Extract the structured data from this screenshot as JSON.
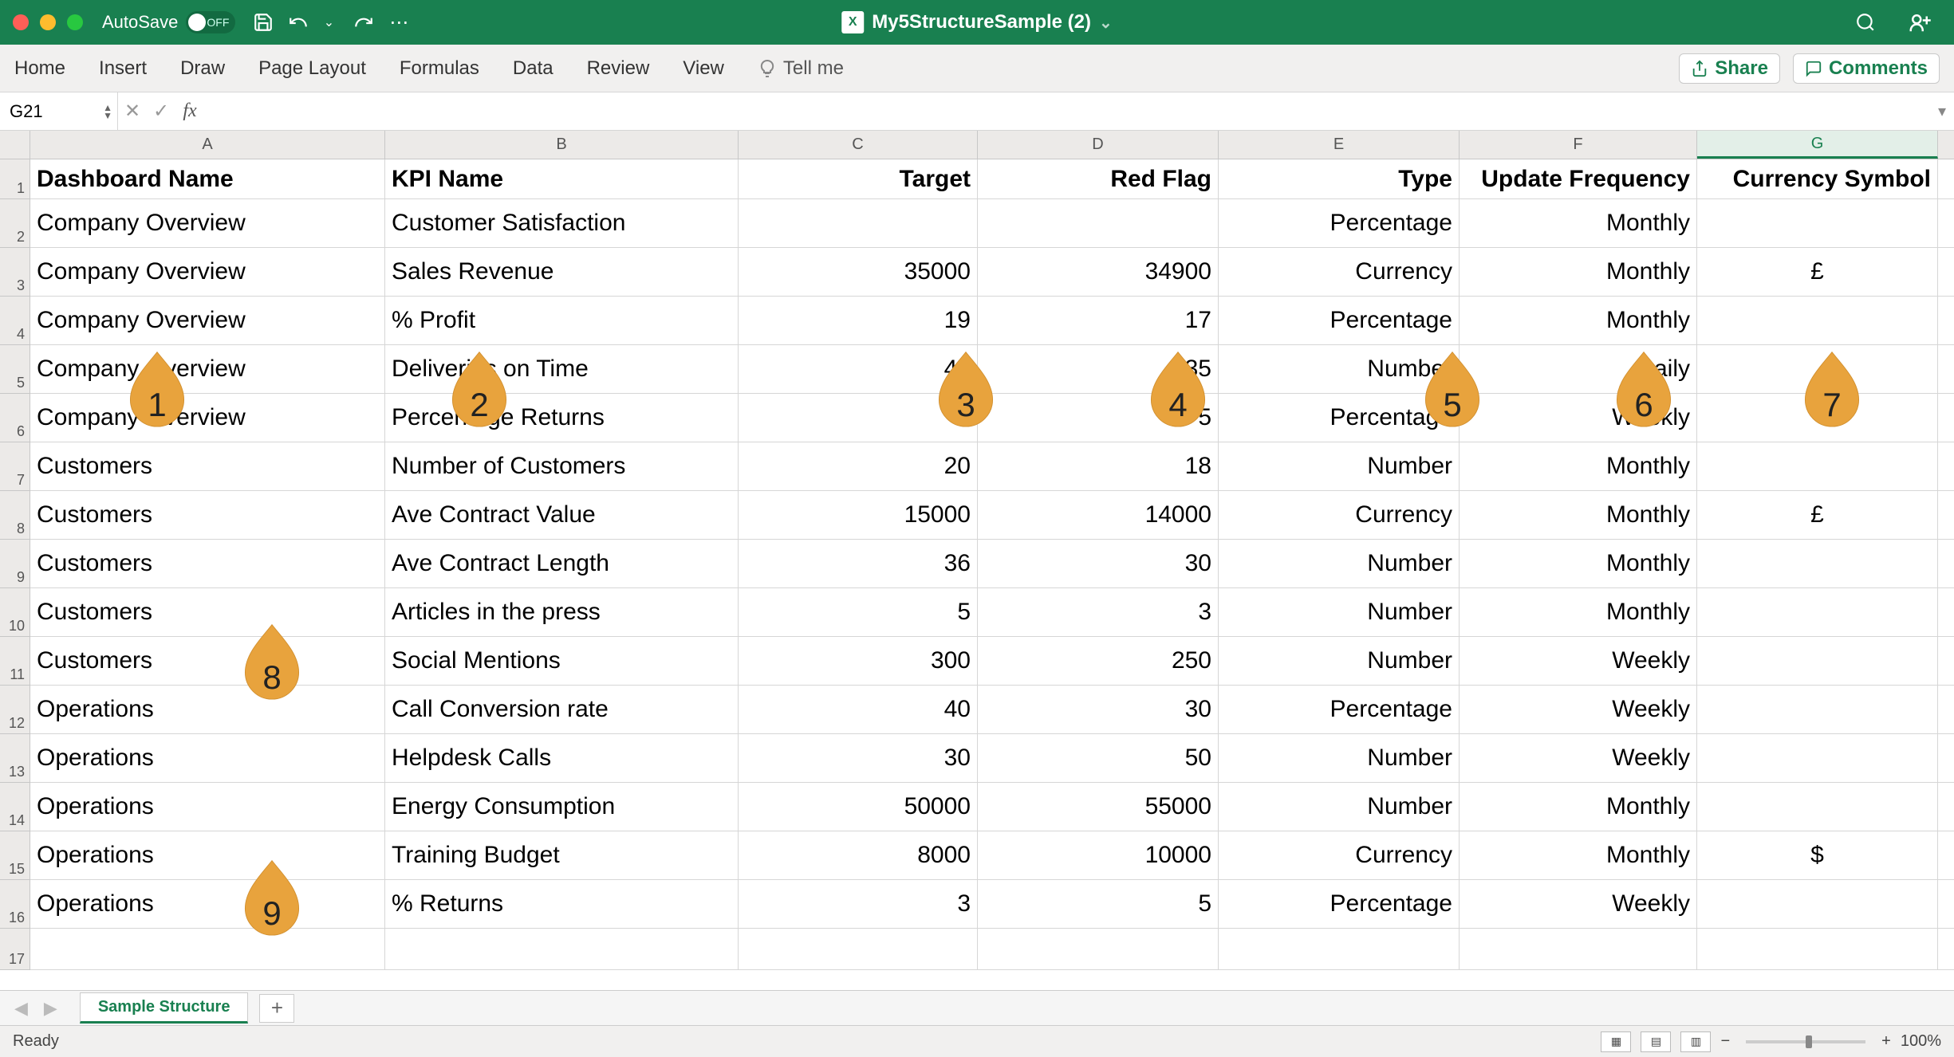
{
  "titlebar": {
    "autosave_label": "AutoSave",
    "autosave_state": "OFF",
    "doc_title": "My5StructureSample (2)"
  },
  "ribbon": {
    "tabs": [
      "Home",
      "Insert",
      "Draw",
      "Page Layout",
      "Formulas",
      "Data",
      "Review",
      "View"
    ],
    "tellme": "Tell me",
    "share": "Share",
    "comments": "Comments"
  },
  "formula_bar": {
    "namebox": "G21",
    "formula": ""
  },
  "columns": [
    "A",
    "B",
    "C",
    "D",
    "E",
    "F",
    "G"
  ],
  "selected_col": "G",
  "headers": {
    "A": "Dashboard Name",
    "B": "KPI Name",
    "C": "Target",
    "D": "Red Flag",
    "E": "Type",
    "F": "Update Frequency",
    "G": "Currency Symbol"
  },
  "rows": [
    {
      "n": 2,
      "A": "Company Overview",
      "B": "Customer Satisfaction",
      "C": "",
      "D": "",
      "E": "Percentage",
      "F": "Monthly",
      "G": ""
    },
    {
      "n": 3,
      "A": "Company Overview",
      "B": "Sales Revenue",
      "C": "35000",
      "D": "34900",
      "E": "Currency",
      "F": "Monthly",
      "G": "£"
    },
    {
      "n": 4,
      "A": "Company Overview",
      "B": "% Profit",
      "C": "19",
      "D": "17",
      "E": "Percentage",
      "F": "Monthly",
      "G": ""
    },
    {
      "n": 5,
      "A": "Company Overview",
      "B": "Deliveries on Time",
      "C": "40",
      "D": "35",
      "E": "Number",
      "F": "Daily",
      "G": ""
    },
    {
      "n": 6,
      "A": "Company Overview",
      "B": "Percentage Returns",
      "C": "3",
      "D": "5",
      "E": "Percentage",
      "F": "Weekly",
      "G": ""
    },
    {
      "n": 7,
      "A": "Customers",
      "B": "Number of Customers",
      "C": "20",
      "D": "18",
      "E": "Number",
      "F": "Monthly",
      "G": ""
    },
    {
      "n": 8,
      "A": "Customers",
      "B": "Ave Contract Value",
      "C": "15000",
      "D": "14000",
      "E": "Currency",
      "F": "Monthly",
      "G": "£"
    },
    {
      "n": 9,
      "A": "Customers",
      "B": "Ave Contract Length",
      "C": "36",
      "D": "30",
      "E": "Number",
      "F": "Monthly",
      "G": ""
    },
    {
      "n": 10,
      "A": "Customers",
      "B": "Articles in the press",
      "C": "5",
      "D": "3",
      "E": "Number",
      "F": "Monthly",
      "G": ""
    },
    {
      "n": 11,
      "A": "Customers",
      "B": "Social Mentions",
      "C": "300",
      "D": "250",
      "E": "Number",
      "F": "Weekly",
      "G": ""
    },
    {
      "n": 12,
      "A": "Operations",
      "B": "Call Conversion rate",
      "C": "40",
      "D": "30",
      "E": "Percentage",
      "F": "Weekly",
      "G": ""
    },
    {
      "n": 13,
      "A": "Operations",
      "B": "Helpdesk Calls",
      "C": "30",
      "D": "50",
      "E": "Number",
      "F": "Weekly",
      "G": ""
    },
    {
      "n": 14,
      "A": "Operations",
      "B": "Energy Consumption",
      "C": "50000",
      "D": "55000",
      "E": "Number",
      "F": "Monthly",
      "G": ""
    },
    {
      "n": 15,
      "A": "Operations",
      "B": "Training Budget",
      "C": "8000",
      "D": "10000",
      "E": "Currency",
      "F": "Monthly",
      "G": "$"
    },
    {
      "n": 16,
      "A": "Operations",
      "B": "% Returns",
      "C": "3",
      "D": "5",
      "E": "Percentage",
      "F": "Weekly",
      "G": ""
    }
  ],
  "callouts": [
    "1",
    "2",
    "3",
    "4",
    "5",
    "6",
    "7",
    "8",
    "9"
  ],
  "sheet": {
    "name": "Sample Structure"
  },
  "status": {
    "ready": "Ready",
    "zoom": "100%"
  }
}
